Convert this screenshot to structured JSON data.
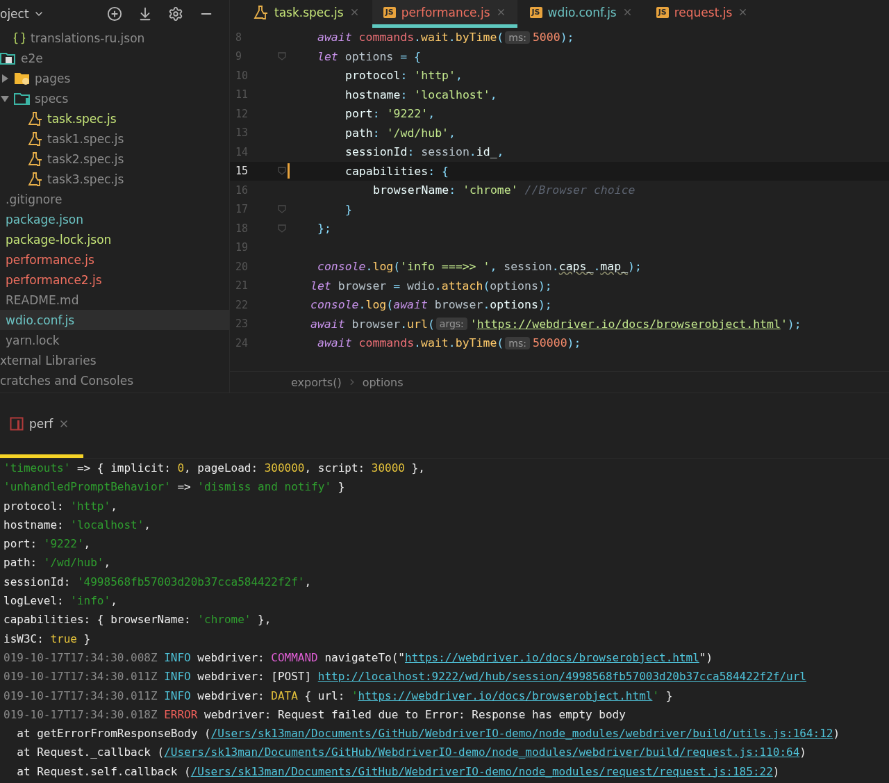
{
  "sidebar": {
    "title": "oject",
    "items": [
      {
        "label": "translations-ru.json",
        "kind": "json",
        "color": "#8c8c8c",
        "selected": false
      },
      {
        "label": "e2e",
        "kind": "module",
        "color": "#8c8c8c",
        "selected": false,
        "children": [
          {
            "label": "pages",
            "kind": "folder",
            "color": "#8c8c8c",
            "selected": false,
            "expanded": false
          },
          {
            "label": "specs",
            "kind": "testfolder",
            "color": "#8c8c8c",
            "selected": false,
            "expanded": true,
            "children": [
              {
                "label": "task.spec.js",
                "kind": "test",
                "color": "#c5e478",
                "selected": false
              },
              {
                "label": "task1.spec.js",
                "kind": "test",
                "color": "#8c8c8c",
                "selected": false
              },
              {
                "label": "task2.spec.js",
                "kind": "test",
                "color": "#8c8c8c",
                "selected": false
              },
              {
                "label": "task3.spec.js",
                "kind": "test",
                "color": "#8c8c8c",
                "selected": false
              }
            ]
          }
        ]
      },
      {
        "label": ".gitignore",
        "kind": "file",
        "color": "#8c8c8c",
        "selected": false
      },
      {
        "label": "package.json",
        "kind": "file",
        "color": "#6cc3c3",
        "selected": false
      },
      {
        "label": "package-lock.json",
        "kind": "file",
        "color": "#c5e478",
        "selected": false
      },
      {
        "label": "performance.js",
        "kind": "file",
        "color": "#f07060",
        "selected": false
      },
      {
        "label": "performance2.js",
        "kind": "file",
        "color": "#f07060",
        "selected": false
      },
      {
        "label": "README.md",
        "kind": "file",
        "color": "#8c8c8c",
        "selected": false
      },
      {
        "label": "wdio.conf.js",
        "kind": "file",
        "color": "#6cc3c3",
        "selected": true
      },
      {
        "label": "yarn.lock",
        "kind": "file",
        "color": "#8c8c8c",
        "selected": false
      },
      {
        "label": "xternal Libraries",
        "kind": "group",
        "color": "#8c8c8c",
        "selected": false
      },
      {
        "label": "cratches and Consoles",
        "kind": "group",
        "color": "#8c8c8c",
        "selected": false
      }
    ]
  },
  "editor": {
    "tabs": [
      {
        "label": "task.spec.js",
        "kind": "test",
        "color": "#c5e478",
        "selected": false
      },
      {
        "label": "performance.js",
        "kind": "js",
        "badge": "JS",
        "color": "#f07060",
        "selected": true
      },
      {
        "label": "wdio.conf.js",
        "kind": "js",
        "badge": "JS",
        "color": "#6cc3c3",
        "selected": false
      },
      {
        "label": "request.js",
        "kind": "js",
        "badge": "JS",
        "color": "#f07060",
        "selected": false
      }
    ],
    "lines": [
      {
        "number": "8",
        "kind": "block",
        "current": false,
        "fold": false,
        "changed": false,
        "tokens": [
          {
            "kind": "kw",
            "text": "await "
          },
          {
            "kind": "mod",
            "text": "commands"
          },
          {
            "kind": "punc",
            "text": "."
          },
          {
            "kind": "fn",
            "text": "wait"
          },
          {
            "kind": "punc",
            "text": "."
          },
          {
            "kind": "fn",
            "text": "byTime"
          },
          {
            "kind": "punc",
            "text": "("
          },
          {
            "kind": "hint",
            "text": "ms:"
          },
          {
            "kind": "num",
            "text": "5000"
          },
          {
            "kind": "punc",
            "text": ");"
          }
        ]
      },
      {
        "number": "9",
        "kind": "block",
        "current": false,
        "fold": true,
        "changed": false,
        "tokens": [
          {
            "kind": "kw",
            "text": "let "
          },
          {
            "kind": "var",
            "text": "options"
          },
          {
            "kind": "punc",
            "text": " = {"
          }
        ]
      },
      {
        "number": "10",
        "kind": "inner",
        "current": false,
        "fold": false,
        "changed": false,
        "tokens": [
          {
            "kind": "prop",
            "text": "protocol"
          },
          {
            "kind": "punc",
            "text": ": "
          },
          {
            "kind": "str",
            "text": "'http'"
          },
          {
            "kind": "punc",
            "text": ","
          }
        ]
      },
      {
        "number": "11",
        "kind": "inner",
        "current": false,
        "fold": false,
        "changed": false,
        "tokens": [
          {
            "kind": "prop",
            "text": "hostname"
          },
          {
            "kind": "punc",
            "text": ": "
          },
          {
            "kind": "str",
            "text": "'localhost'"
          },
          {
            "kind": "punc",
            "text": ","
          }
        ]
      },
      {
        "number": "12",
        "kind": "inner",
        "current": false,
        "fold": false,
        "changed": false,
        "tokens": [
          {
            "kind": "prop",
            "text": "port"
          },
          {
            "kind": "punc",
            "text": ": "
          },
          {
            "kind": "str",
            "text": "'9222'"
          },
          {
            "kind": "punc",
            "text": ","
          }
        ]
      },
      {
        "number": "13",
        "kind": "inner",
        "current": false,
        "fold": false,
        "changed": false,
        "tokens": [
          {
            "kind": "prop",
            "text": "path"
          },
          {
            "kind": "punc",
            "text": ": "
          },
          {
            "kind": "str",
            "text": "'/wd/hub'"
          },
          {
            "kind": "punc",
            "text": ","
          }
        ]
      },
      {
        "number": "14",
        "kind": "inner",
        "current": false,
        "fold": false,
        "changed": false,
        "tokens": [
          {
            "kind": "prop",
            "text": "sessionId"
          },
          {
            "kind": "punc",
            "text": ": "
          },
          {
            "kind": "var",
            "text": "session"
          },
          {
            "kind": "punc",
            "text": "."
          },
          {
            "kind": "prop",
            "text": "id_"
          },
          {
            "kind": "punc",
            "text": ","
          }
        ]
      },
      {
        "number": "15",
        "kind": "inner",
        "current": true,
        "fold": true,
        "changed": true,
        "tokens": [
          {
            "kind": "prop",
            "text": "capabilities"
          },
          {
            "kind": "punc",
            "text": ": {"
          }
        ]
      },
      {
        "number": "16",
        "kind": "deepest",
        "current": false,
        "fold": false,
        "changed": false,
        "tokens": [
          {
            "kind": "prop",
            "text": "browserName"
          },
          {
            "kind": "punc",
            "text": ": "
          },
          {
            "kind": "str",
            "text": "'chrome'"
          },
          {
            "kind": "cmt",
            "text": " //Browser choice"
          }
        ]
      },
      {
        "number": "17",
        "kind": "inner",
        "current": false,
        "fold": true,
        "changed": false,
        "tokens": [
          {
            "kind": "punc",
            "text": "}"
          }
        ]
      },
      {
        "number": "18",
        "kind": "block",
        "current": false,
        "fold": true,
        "changed": false,
        "tokens": [
          {
            "kind": "punc",
            "text": "};"
          }
        ]
      },
      {
        "number": "19",
        "current": false,
        "fold": false,
        "changed": false
      },
      {
        "number": "20",
        "kind": "block",
        "current": false,
        "fold": false,
        "changed": false,
        "tokens": [
          {
            "kind": "kw",
            "text": "console"
          },
          {
            "kind": "punc",
            "text": "."
          },
          {
            "kind": "fn",
            "text": "log"
          },
          {
            "kind": "punc",
            "text": "("
          },
          {
            "kind": "str",
            "text": "'info ===>> '"
          },
          {
            "kind": "punc",
            "text": ", "
          },
          {
            "kind": "var",
            "text": "session"
          },
          {
            "kind": "punc",
            "text": "."
          },
          {
            "kind": "warn",
            "text": "caps_"
          },
          {
            "kind": "punc",
            "text": "."
          },
          {
            "kind": "warn",
            "text": "map_"
          },
          {
            "kind": "punc",
            "text": ");"
          }
        ]
      },
      {
        "number": "21",
        "kind": "outer",
        "current": false,
        "fold": false,
        "changed": false,
        "tokens": [
          {
            "kind": "kw",
            "text": "let "
          },
          {
            "kind": "var",
            "text": "browser"
          },
          {
            "kind": "punc",
            "text": " = "
          },
          {
            "kind": "var",
            "text": "wdio"
          },
          {
            "kind": "punc",
            "text": "."
          },
          {
            "kind": "fn",
            "text": "attach"
          },
          {
            "kind": "punc",
            "text": "("
          },
          {
            "kind": "var",
            "text": "options"
          },
          {
            "kind": "punc",
            "text": ");"
          }
        ]
      },
      {
        "number": "22",
        "kind": "outer",
        "current": false,
        "fold": false,
        "changed": false,
        "tokens": [
          {
            "kind": "kw",
            "text": "console"
          },
          {
            "kind": "punc",
            "text": "."
          },
          {
            "kind": "fn",
            "text": "log"
          },
          {
            "kind": "punc",
            "text": "("
          },
          {
            "kind": "kw",
            "text": "await "
          },
          {
            "kind": "var",
            "text": "browser"
          },
          {
            "kind": "punc",
            "text": "."
          },
          {
            "kind": "prop",
            "text": "options"
          },
          {
            "kind": "punc",
            "text": ");"
          }
        ]
      },
      {
        "number": "23",
        "kind": "outer",
        "current": false,
        "fold": false,
        "changed": false,
        "tokens": [
          {
            "kind": "kw",
            "text": "await "
          },
          {
            "kind": "var",
            "text": "browser"
          },
          {
            "kind": "punc",
            "text": "."
          },
          {
            "kind": "fn",
            "text": "url"
          },
          {
            "kind": "punc",
            "text": "("
          },
          {
            "kind": "hint",
            "text": "args:"
          },
          {
            "kind": "str",
            "text": "'"
          },
          {
            "kind": "link",
            "text": "https://webdriver.io/docs/browserobject.html"
          },
          {
            "kind": "str",
            "text": "'"
          },
          {
            "kind": "punc",
            "text": ");"
          }
        ]
      },
      {
        "number": "24",
        "kind": "block",
        "current": false,
        "fold": false,
        "changed": false,
        "tokens": [
          {
            "kind": "kw",
            "text": "await "
          },
          {
            "kind": "mod",
            "text": "commands"
          },
          {
            "kind": "punc",
            "text": "."
          },
          {
            "kind": "fn",
            "text": "wait"
          },
          {
            "kind": "punc",
            "text": "."
          },
          {
            "kind": "fn",
            "text": "byTime"
          },
          {
            "kind": "punc",
            "text": "("
          },
          {
            "kind": "hint",
            "text": "ms:"
          },
          {
            "kind": "num",
            "text": "50000"
          },
          {
            "kind": "punc",
            "text": ");"
          }
        ]
      }
    ],
    "breadcrumb": [
      "exports()",
      "options"
    ]
  },
  "panel": {
    "tab": {
      "label": "perf",
      "selected": true
    },
    "lines": [
      {
        "segments": [
          {
            "kind": "str",
            "text": "'timeouts'"
          },
          {
            "kind": "txt",
            "text": " => { implicit: "
          },
          {
            "kind": "num",
            "text": "0"
          },
          {
            "kind": "txt",
            "text": ", pageLoad: "
          },
          {
            "kind": "num",
            "text": "300000"
          },
          {
            "kind": "txt",
            "text": ", script: "
          },
          {
            "kind": "num",
            "text": "30000"
          },
          {
            "kind": "txt",
            "text": " },"
          }
        ]
      },
      {
        "segments": [
          {
            "kind": "str",
            "text": "'unhandledPromptBehavior'"
          },
          {
            "kind": "txt",
            "text": " => "
          },
          {
            "kind": "str",
            "text": "'dismiss and notify'"
          },
          {
            "kind": "txt",
            "text": " }"
          }
        ]
      },
      {
        "segments": [
          {
            "kind": "txt",
            "text": "protocol: "
          },
          {
            "kind": "str",
            "text": "'http'"
          },
          {
            "kind": "txt",
            "text": ","
          }
        ]
      },
      {
        "segments": [
          {
            "kind": "txt",
            "text": "hostname: "
          },
          {
            "kind": "str",
            "text": "'localhost'"
          },
          {
            "kind": "txt",
            "text": ","
          }
        ]
      },
      {
        "segments": [
          {
            "kind": "txt",
            "text": "port: "
          },
          {
            "kind": "str",
            "text": "'9222'"
          },
          {
            "kind": "txt",
            "text": ","
          }
        ]
      },
      {
        "segments": [
          {
            "kind": "txt",
            "text": "path: "
          },
          {
            "kind": "str",
            "text": "'/wd/hub'"
          },
          {
            "kind": "txt",
            "text": ","
          }
        ]
      },
      {
        "segments": [
          {
            "kind": "txt",
            "text": "sessionId: "
          },
          {
            "kind": "str",
            "text": "'4998568fb57003d20b37cca584422f2f'"
          },
          {
            "kind": "txt",
            "text": ","
          }
        ]
      },
      {
        "segments": [
          {
            "kind": "txt",
            "text": "logLevel: "
          },
          {
            "kind": "str",
            "text": "'info'"
          },
          {
            "kind": "txt",
            "text": ","
          }
        ]
      },
      {
        "segments": [
          {
            "kind": "txt",
            "text": "capabilities: { browserName: "
          },
          {
            "kind": "str",
            "text": "'chrome'"
          },
          {
            "kind": "txt",
            "text": " },"
          }
        ]
      },
      {
        "segments": [
          {
            "kind": "txt",
            "text": "isW3C: "
          },
          {
            "kind": "num",
            "text": "true"
          },
          {
            "kind": "txt",
            "text": " }"
          }
        ]
      },
      {
        "segments": [
          {
            "kind": "ts",
            "text": "019-10-17T17:34:30.008Z "
          },
          {
            "kind": "info",
            "text": "INFO"
          },
          {
            "kind": "txt",
            "text": " webdriver: "
          },
          {
            "kind": "cmd",
            "text": "COMMAND"
          },
          {
            "kind": "txt",
            "text": " navigateTo(\""
          },
          {
            "kind": "link",
            "text": "https://webdriver.io/docs/browserobject.html"
          },
          {
            "kind": "txt",
            "text": "\")"
          }
        ]
      },
      {
        "segments": [
          {
            "kind": "ts",
            "text": "019-10-17T17:34:30.011Z "
          },
          {
            "kind": "info",
            "text": "INFO"
          },
          {
            "kind": "txt",
            "text": " webdriver: [POST] "
          },
          {
            "kind": "link",
            "text": "http://localhost:9222/wd/hub/session/4998568fb57003d20b37cca584422f2f/url"
          }
        ]
      },
      {
        "segments": [
          {
            "kind": "ts",
            "text": "019-10-17T17:34:30.011Z "
          },
          {
            "kind": "info",
            "text": "INFO"
          },
          {
            "kind": "txt",
            "text": " webdriver: "
          },
          {
            "kind": "data",
            "text": "DATA"
          },
          {
            "kind": "txt",
            "text": " { url: "
          },
          {
            "kind": "str",
            "text": "'"
          },
          {
            "kind": "link",
            "text": "https://webdriver.io/docs/browserobject.html"
          },
          {
            "kind": "str",
            "text": "'"
          },
          {
            "kind": "txt",
            "text": " }"
          }
        ]
      },
      {
        "segments": [
          {
            "kind": "ts",
            "text": "019-10-17T17:34:30.018Z "
          },
          {
            "kind": "err",
            "text": "ERROR"
          },
          {
            "kind": "txt",
            "text": " webdriver: Request failed due to Error: Response has empty body"
          }
        ]
      },
      {
        "segments": [
          {
            "kind": "txt",
            "text": "  at getErrorFromResponseBody ("
          },
          {
            "kind": "link",
            "text": "/Users/sk13man/Documents/GitHub/WebdriverIO-demo/node_modules/webdriver/build/utils.js:164:12"
          },
          {
            "kind": "txt",
            "text": ")"
          }
        ]
      },
      {
        "segments": [
          {
            "kind": "txt",
            "text": "  at Request._callback ("
          },
          {
            "kind": "link",
            "text": "/Users/sk13man/Documents/GitHub/WebdriverIO-demo/node_modules/webdriver/build/request.js:110:64"
          },
          {
            "kind": "txt",
            "text": ")"
          }
        ]
      },
      {
        "segments": [
          {
            "kind": "txt",
            "text": "  at Request.self.callback ("
          },
          {
            "kind": "link",
            "text": "/Users/sk13man/Documents/GitHub/WebdriverIO-demo/node_modules/request/request.js:185:22"
          },
          {
            "kind": "txt",
            "text": ")"
          }
        ]
      }
    ]
  }
}
